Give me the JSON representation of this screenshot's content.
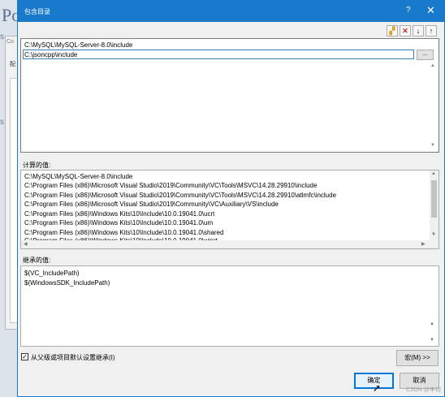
{
  "background": {
    "logo_text": "Po",
    "tab_text": "Co",
    "label_text": "配",
    "side_mark_1": "s",
    "side_mark_2": "s"
  },
  "dialog": {
    "title": "包含目录",
    "help_label": "?",
    "close_label": "✕"
  },
  "toolbar": {
    "new_line_icon": "folder-icon",
    "delete_icon": "delete-icon",
    "move_down_glyph": "↓",
    "move_up_glyph": "↑",
    "folder_glyph": "▞",
    "delete_glyph": "✕"
  },
  "editor": {
    "lines": [
      "C:\\MySQL\\MySQL-Server-8.0\\include",
      "C:\\jsoncpp\\include"
    ],
    "browse_label": "..."
  },
  "computed": {
    "label": "计算的值:",
    "lines": [
      "C:\\MySQL\\MySQL-Server-8.0\\include",
      "C:\\Program Files (x86)\\Microsoft Visual Studio\\2019\\Community\\VC\\Tools\\MSVC\\14.28.29910\\include",
      "C:\\Program Files (x86)\\Microsoft Visual Studio\\2019\\Community\\VC\\Tools\\MSVC\\14.28.29910\\atlmfc\\include",
      "C:\\Program Files (x86)\\Microsoft Visual Studio\\2019\\Community\\VC\\Auxiliary\\VS\\include",
      "C:\\Program Files (x86)\\Windows Kits\\10\\Include\\10.0.19041.0\\ucrt",
      "C:\\Program Files (x86)\\Windows Kits\\10\\Include\\10.0.19041.0\\um",
      "C:\\Program Files (x86)\\Windows Kits\\10\\Include\\10.0.19041.0\\shared",
      "C:\\Program Files (x86)\\Windows Kits\\10\\Include\\10.0.19041.0\\winrt"
    ]
  },
  "inherited": {
    "label": "继承的值:",
    "lines": [
      "$(VC_IncludePath)",
      "$(WindowsSDK_IncludePath)"
    ]
  },
  "inherit_checkbox": {
    "label": "从父级或项目默认设置继承(I)",
    "checked": true,
    "mark": "✓"
  },
  "buttons": {
    "macros": "宏(M) >>",
    "ok": "确定",
    "cancel": "取消"
  },
  "watermark": "CSDN @丰钧"
}
